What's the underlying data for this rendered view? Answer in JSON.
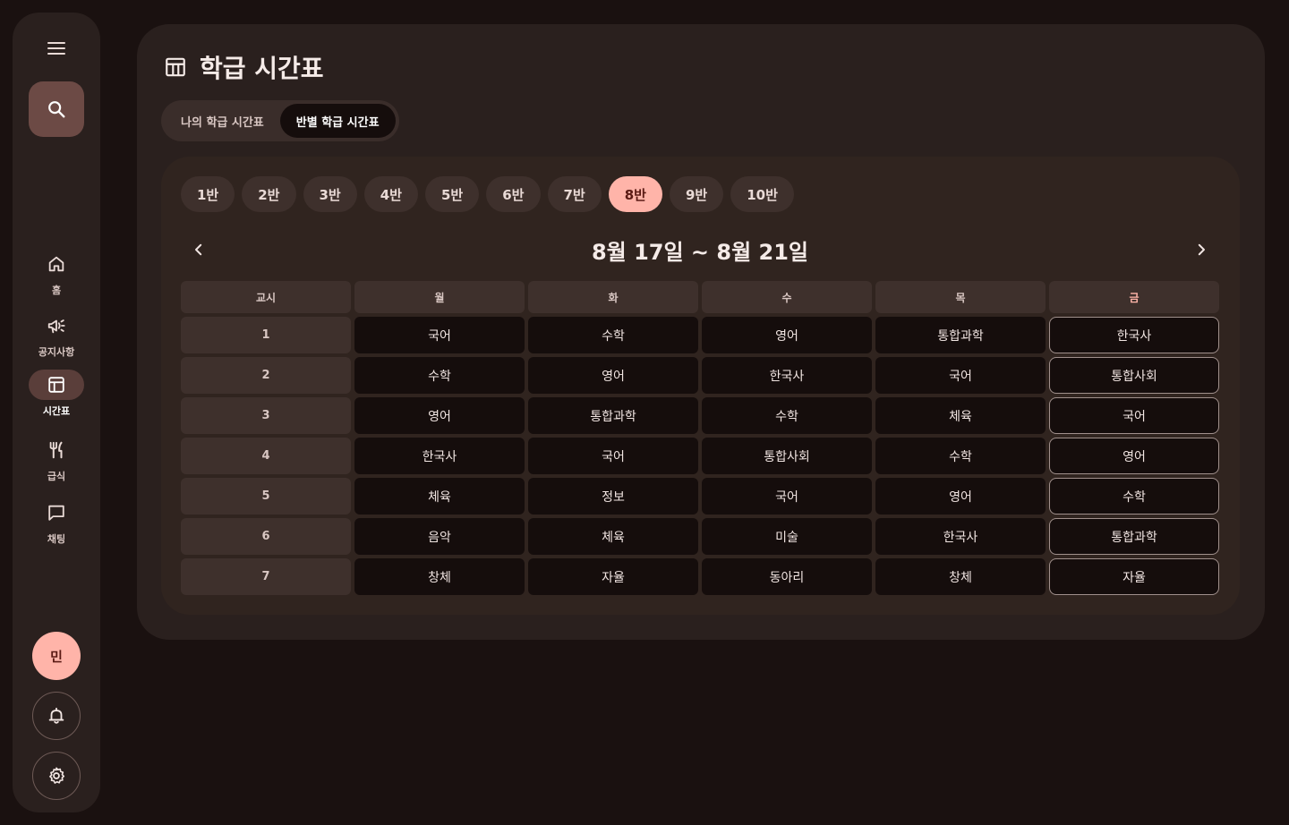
{
  "sidebar": {
    "items": [
      {
        "id": "home",
        "label": "홈",
        "icon": "home-icon"
      },
      {
        "id": "notice",
        "label": "공지사항",
        "icon": "megaphone-icon"
      },
      {
        "id": "timetable",
        "label": "시간표",
        "icon": "table-icon",
        "active": true
      },
      {
        "id": "meal",
        "label": "급식",
        "icon": "utensils-icon"
      },
      {
        "id": "chat",
        "label": "채팅",
        "icon": "chat-icon"
      }
    ],
    "avatar_initial": "민"
  },
  "header": {
    "title": "학급 시간표",
    "tabs": [
      {
        "label": "나의 학급 시간표",
        "selected": false
      },
      {
        "label": "반별 학급 시간표",
        "selected": true
      }
    ]
  },
  "classes": [
    "1반",
    "2반",
    "3반",
    "4반",
    "5반",
    "6반",
    "7반",
    "8반",
    "9반",
    "10반"
  ],
  "selected_class_index": 7,
  "week_label": "8월 17일 ~ 8월 21일",
  "timetable": {
    "period_header": "교시",
    "days": [
      "월",
      "화",
      "수",
      "목",
      "금"
    ],
    "today_index": 4,
    "rows": [
      {
        "period": "1",
        "subjects": [
          "국어",
          "수학",
          "영어",
          "통합과학",
          "한국사"
        ]
      },
      {
        "period": "2",
        "subjects": [
          "수학",
          "영어",
          "한국사",
          "국어",
          "통합사회"
        ]
      },
      {
        "period": "3",
        "subjects": [
          "영어",
          "통합과학",
          "수학",
          "체육",
          "국어"
        ]
      },
      {
        "period": "4",
        "subjects": [
          "한국사",
          "국어",
          "통합사회",
          "수학",
          "영어"
        ]
      },
      {
        "period": "5",
        "subjects": [
          "체육",
          "정보",
          "국어",
          "영어",
          "수학"
        ]
      },
      {
        "period": "6",
        "subjects": [
          "음악",
          "체육",
          "미술",
          "한국사",
          "통합과학"
        ]
      },
      {
        "period": "7",
        "subjects": [
          "창체",
          "자율",
          "동아리",
          "창체",
          "자율"
        ]
      }
    ]
  },
  "colors": {
    "background": "#1a1110",
    "surface": "#2a201e",
    "accent": "#ffb4a9",
    "cell": "#150d0c"
  }
}
